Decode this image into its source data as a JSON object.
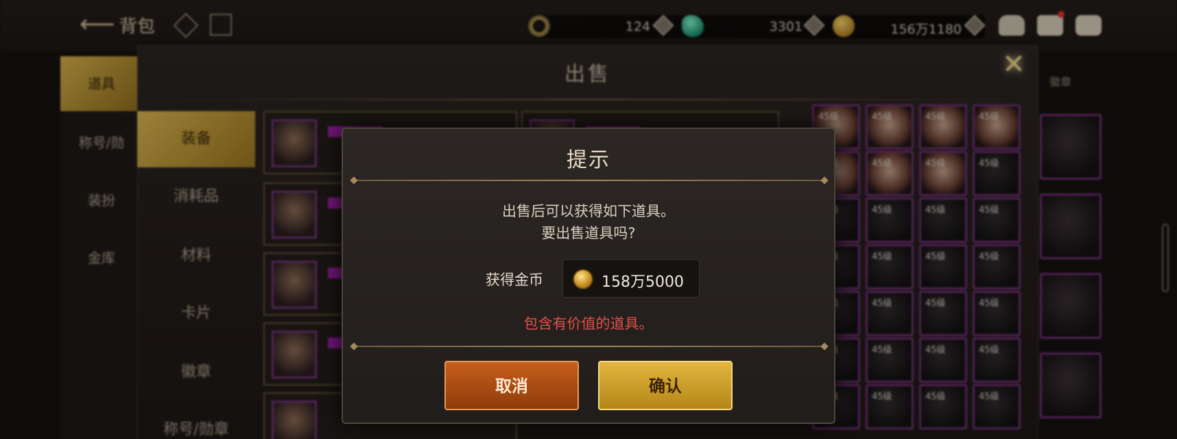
{
  "topbar": {
    "title": "背包",
    "currencies": [
      {
        "icon": "crescent-token-icon",
        "value": "124"
      },
      {
        "icon": "green-gem-icon",
        "value": "3301"
      },
      {
        "icon": "gold-coin-icon",
        "value": "156万1180"
      }
    ]
  },
  "left_nav": [
    "道具",
    "称号/勋",
    "装扮",
    "金库"
  ],
  "right_tab": "徽章",
  "sell_panel": {
    "title": "出售",
    "categories": [
      "装备",
      "消耗品",
      "材料",
      "卡片",
      "徽章",
      "称号/勋章"
    ],
    "slot_label": "45级"
  },
  "dialog": {
    "title": "提示",
    "message_line1": "出售后可以获得如下道具。",
    "message_line2": "要出售道具吗?",
    "reward_label": "获得金币",
    "reward_value": "158万5000",
    "warning": "包含有价值的道具。",
    "cancel_label": "取消",
    "confirm_label": "确认"
  },
  "colors": {
    "accent_gold": "#d9b450",
    "cancel_orange": "#c65e1c",
    "warning_red": "#e0504a",
    "item_border_purple": "#6e2f72"
  }
}
